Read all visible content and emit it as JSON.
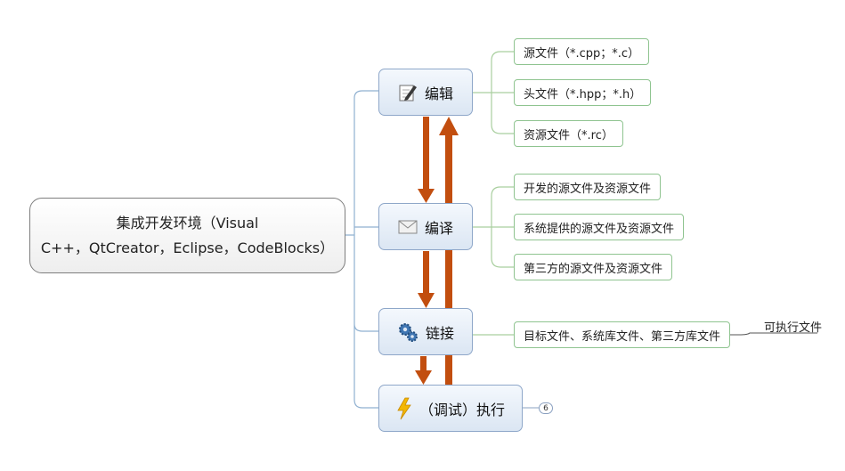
{
  "root": {
    "line1": "集成开发环境（Visual",
    "line2": "C++，QtCreator，Eclipse，CodeBlocks）"
  },
  "steps": {
    "edit": {
      "label": "编辑",
      "icon": "pencil-notepad-icon",
      "children": [
        "源文件（*.cpp；*.c）",
        "头文件（*.hpp；*.h）",
        "资源文件（*.rc）"
      ]
    },
    "compile": {
      "label": "编译",
      "icon": "envelope-icon",
      "children": [
        "开发的源文件及资源文件",
        "系统提供的源文件及资源文件",
        "第三方的源文件及资源文件"
      ]
    },
    "link": {
      "label": "链接",
      "icon": "gears-icon",
      "children": [
        "目标文件、系统库文件、第三方库文件"
      ],
      "output": "可执行文件"
    },
    "run": {
      "label": "（调试）执行",
      "icon": "lightning-icon",
      "badge": "6"
    }
  },
  "colors": {
    "arrow": "#c24e0f",
    "main_border": "#8ea7c9",
    "leaf_border": "#8fc490",
    "connector": "#8fb0d0"
  }
}
